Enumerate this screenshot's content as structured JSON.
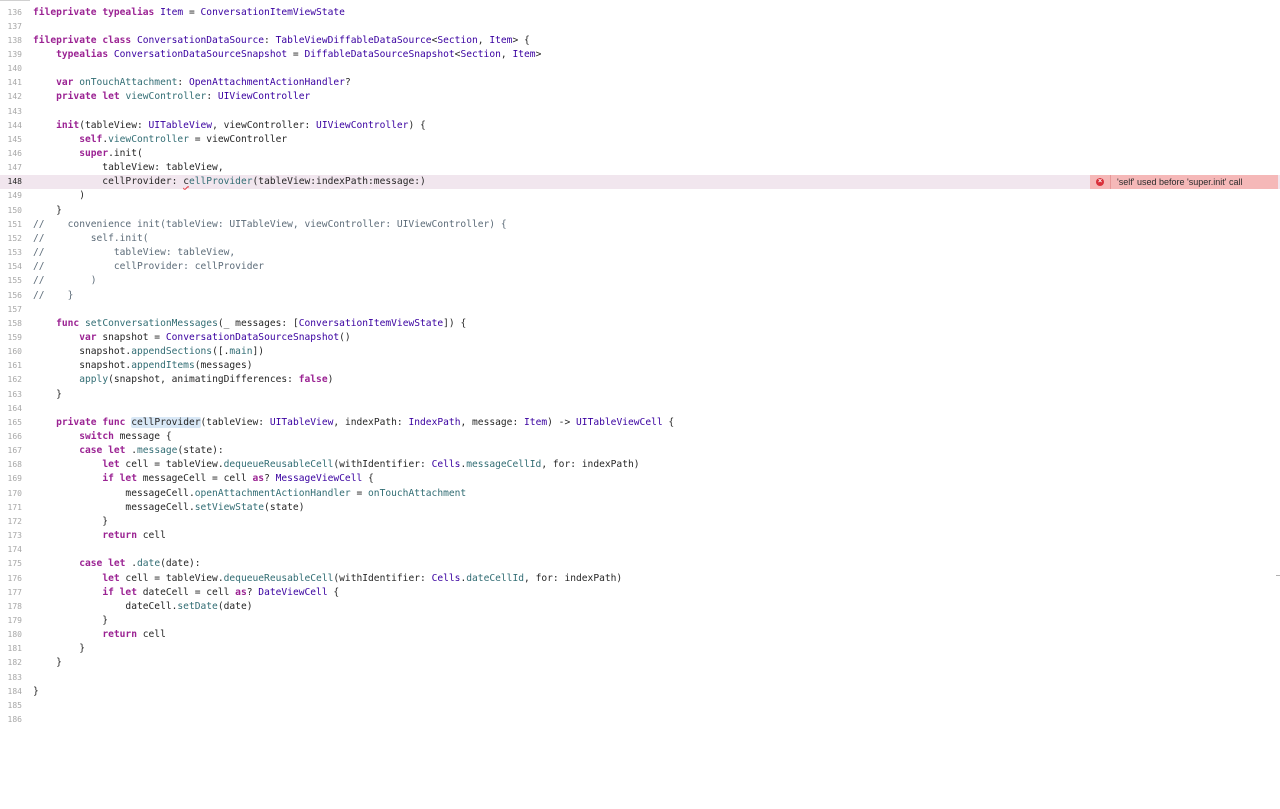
{
  "editor": {
    "error": {
      "line_number": "148",
      "message": "'self' used before 'super.init' call"
    },
    "lines": [
      {
        "n": "136",
        "tokens": [
          [
            "kw",
            "fileprivate "
          ],
          [
            "kw",
            "typealias "
          ],
          [
            "ty",
            "Item"
          ],
          [
            "tx",
            " = "
          ],
          [
            "ty",
            "ConversationItemViewState"
          ]
        ]
      },
      {
        "n": "137",
        "tokens": []
      },
      {
        "n": "138",
        "tokens": [
          [
            "kw",
            "fileprivate "
          ],
          [
            "kw",
            "class "
          ],
          [
            "ty",
            "ConversationDataSource"
          ],
          [
            "tx",
            ": "
          ],
          [
            "ty",
            "TableViewDiffableDataSource"
          ],
          [
            "tx",
            "<"
          ],
          [
            "ty",
            "Section"
          ],
          [
            "tx",
            ", "
          ],
          [
            "ty",
            "Item"
          ],
          [
            "tx",
            "> {"
          ]
        ]
      },
      {
        "n": "139",
        "tokens": [
          [
            "tx",
            "    "
          ],
          [
            "kw",
            "typealias "
          ],
          [
            "ty",
            "ConversationDataSourceSnapshot"
          ],
          [
            "tx",
            " = "
          ],
          [
            "ty",
            "DiffableDataSourceSnapshot"
          ],
          [
            "tx",
            "<"
          ],
          [
            "ty",
            "Section"
          ],
          [
            "tx",
            ", "
          ],
          [
            "ty",
            "Item"
          ],
          [
            "tx",
            ">"
          ]
        ]
      },
      {
        "n": "140",
        "tokens": []
      },
      {
        "n": "141",
        "tokens": [
          [
            "tx",
            "    "
          ],
          [
            "kw",
            "var "
          ],
          [
            "fn",
            "onTouchAttachment"
          ],
          [
            "tx",
            ": "
          ],
          [
            "ty",
            "OpenAttachmentActionHandler"
          ],
          [
            "tx",
            "?"
          ]
        ]
      },
      {
        "n": "142",
        "tokens": [
          [
            "tx",
            "    "
          ],
          [
            "kw",
            "private "
          ],
          [
            "kw",
            "let "
          ],
          [
            "fn",
            "viewController"
          ],
          [
            "tx",
            ": "
          ],
          [
            "ty",
            "UIViewController"
          ]
        ]
      },
      {
        "n": "143",
        "tokens": []
      },
      {
        "n": "144",
        "tokens": [
          [
            "tx",
            "    "
          ],
          [
            "kw",
            "init"
          ],
          [
            "tx",
            "(tableView: "
          ],
          [
            "ty",
            "UITableView"
          ],
          [
            "tx",
            ", viewController: "
          ],
          [
            "ty",
            "UIViewController"
          ],
          [
            "tx",
            ") {"
          ]
        ]
      },
      {
        "n": "145",
        "tokens": [
          [
            "tx",
            "        "
          ],
          [
            "kw",
            "self"
          ],
          [
            "tx",
            "."
          ],
          [
            "fn",
            "viewController"
          ],
          [
            "tx",
            " = viewController"
          ]
        ]
      },
      {
        "n": "146",
        "tokens": [
          [
            "tx",
            "        "
          ],
          [
            "kw",
            "super"
          ],
          [
            "tx",
            ".init("
          ]
        ]
      },
      {
        "n": "147",
        "tokens": [
          [
            "tx",
            "            tableView: tableView,"
          ]
        ]
      },
      {
        "n": "148",
        "error": true,
        "tokens": [
          [
            "tx",
            "            cellProvider: "
          ],
          [
            "err",
            "c"
          ],
          [
            "fn",
            "ellProvider"
          ],
          [
            "tx",
            "(tableView:indexPath:message:)"
          ]
        ]
      },
      {
        "n": "149",
        "tokens": [
          [
            "tx",
            "        )"
          ]
        ]
      },
      {
        "n": "150",
        "tokens": [
          [
            "tx",
            "    }"
          ]
        ]
      },
      {
        "n": "151",
        "tokens": [
          [
            "cm",
            "//    convenience init(tableView: UITableView, viewController: UIViewController) {"
          ]
        ]
      },
      {
        "n": "152",
        "tokens": [
          [
            "cm",
            "//        self.init("
          ]
        ]
      },
      {
        "n": "153",
        "tokens": [
          [
            "cm",
            "//            tableView: tableView,"
          ]
        ]
      },
      {
        "n": "154",
        "tokens": [
          [
            "cm",
            "//            cellProvider: cellProvider"
          ]
        ]
      },
      {
        "n": "155",
        "tokens": [
          [
            "cm",
            "//        )"
          ]
        ]
      },
      {
        "n": "156",
        "tokens": [
          [
            "cm",
            "//    }"
          ]
        ]
      },
      {
        "n": "157",
        "tokens": []
      },
      {
        "n": "158",
        "tokens": [
          [
            "tx",
            "    "
          ],
          [
            "kw",
            "func "
          ],
          [
            "fn",
            "setConversationMessages"
          ],
          [
            "tx",
            "(_ messages: ["
          ],
          [
            "ty",
            "ConversationItemViewState"
          ],
          [
            "tx",
            "]) {"
          ]
        ]
      },
      {
        "n": "159",
        "tokens": [
          [
            "tx",
            "        "
          ],
          [
            "kw",
            "var "
          ],
          [
            "tx",
            "snapshot = "
          ],
          [
            "ty",
            "ConversationDataSourceSnapshot"
          ],
          [
            "tx",
            "()"
          ]
        ]
      },
      {
        "n": "160",
        "tokens": [
          [
            "tx",
            "        snapshot."
          ],
          [
            "fn",
            "appendSections"
          ],
          [
            "tx",
            "([."
          ],
          [
            "fn",
            "main"
          ],
          [
            "tx",
            "])"
          ]
        ]
      },
      {
        "n": "161",
        "tokens": [
          [
            "tx",
            "        snapshot."
          ],
          [
            "fn",
            "appendItems"
          ],
          [
            "tx",
            "(messages)"
          ]
        ]
      },
      {
        "n": "162",
        "tokens": [
          [
            "tx",
            "        "
          ],
          [
            "fn",
            "apply"
          ],
          [
            "tx",
            "(snapshot, animatingDifferences: "
          ],
          [
            "kw",
            "false"
          ],
          [
            "tx",
            ")"
          ]
        ]
      },
      {
        "n": "163",
        "tokens": [
          [
            "tx",
            "    }"
          ]
        ]
      },
      {
        "n": "164",
        "tokens": []
      },
      {
        "n": "165",
        "tokens": [
          [
            "tx",
            "    "
          ],
          [
            "kw",
            "private "
          ],
          [
            "kw",
            "func "
          ],
          [
            "hl",
            "cellProvider"
          ],
          [
            "tx",
            "(tableView: "
          ],
          [
            "ty",
            "UITableView"
          ],
          [
            "tx",
            ", indexPath: "
          ],
          [
            "ty",
            "IndexPath"
          ],
          [
            "tx",
            ", message: "
          ],
          [
            "ty",
            "Item"
          ],
          [
            "tx",
            ") -> "
          ],
          [
            "ty",
            "UITableViewCell"
          ],
          [
            "tx",
            " {"
          ]
        ]
      },
      {
        "n": "166",
        "tokens": [
          [
            "tx",
            "        "
          ],
          [
            "kw",
            "switch "
          ],
          [
            "tx",
            "message {"
          ]
        ]
      },
      {
        "n": "167",
        "tokens": [
          [
            "tx",
            "        "
          ],
          [
            "kw",
            "case "
          ],
          [
            "kw",
            "let "
          ],
          [
            "tx",
            "."
          ],
          [
            "fn",
            "message"
          ],
          [
            "tx",
            "(state):"
          ]
        ]
      },
      {
        "n": "168",
        "tokens": [
          [
            "tx",
            "            "
          ],
          [
            "kw",
            "let "
          ],
          [
            "tx",
            "cell = tableView."
          ],
          [
            "fn",
            "dequeueReusableCell"
          ],
          [
            "tx",
            "(withIdentifier: "
          ],
          [
            "ty",
            "Cells"
          ],
          [
            "tx",
            "."
          ],
          [
            "fn",
            "messageCellId"
          ],
          [
            "tx",
            ", for: indexPath)"
          ]
        ]
      },
      {
        "n": "169",
        "tokens": [
          [
            "tx",
            "            "
          ],
          [
            "kw",
            "if "
          ],
          [
            "kw",
            "let "
          ],
          [
            "tx",
            "messageCell = cell "
          ],
          [
            "kw",
            "as"
          ],
          [
            "tx",
            "? "
          ],
          [
            "ty",
            "MessageViewCell"
          ],
          [
            "tx",
            " {"
          ]
        ]
      },
      {
        "n": "170",
        "tokens": [
          [
            "tx",
            "                messageCell."
          ],
          [
            "fn",
            "openAttachmentActionHandler"
          ],
          [
            "tx",
            " = "
          ],
          [
            "fn",
            "onTouchAttachment"
          ]
        ]
      },
      {
        "n": "171",
        "tokens": [
          [
            "tx",
            "                messageCell."
          ],
          [
            "fn",
            "setViewState"
          ],
          [
            "tx",
            "(state)"
          ]
        ]
      },
      {
        "n": "172",
        "tokens": [
          [
            "tx",
            "            }"
          ]
        ]
      },
      {
        "n": "173",
        "tokens": [
          [
            "tx",
            "            "
          ],
          [
            "kw",
            "return "
          ],
          [
            "tx",
            "cell"
          ]
        ]
      },
      {
        "n": "174",
        "tokens": []
      },
      {
        "n": "175",
        "tokens": [
          [
            "tx",
            "        "
          ],
          [
            "kw",
            "case "
          ],
          [
            "kw",
            "let "
          ],
          [
            "tx",
            "."
          ],
          [
            "fn",
            "date"
          ],
          [
            "tx",
            "(date):"
          ]
        ]
      },
      {
        "n": "176",
        "tokens": [
          [
            "tx",
            "            "
          ],
          [
            "kw",
            "let "
          ],
          [
            "tx",
            "cell = tableView."
          ],
          [
            "fn",
            "dequeueReusableCell"
          ],
          [
            "tx",
            "(withIdentifier: "
          ],
          [
            "ty",
            "Cells"
          ],
          [
            "tx",
            "."
          ],
          [
            "fn",
            "dateCellId"
          ],
          [
            "tx",
            ", for: indexPath)"
          ]
        ]
      },
      {
        "n": "177",
        "tokens": [
          [
            "tx",
            "            "
          ],
          [
            "kw",
            "if "
          ],
          [
            "kw",
            "let "
          ],
          [
            "tx",
            "dateCell = cell "
          ],
          [
            "kw",
            "as"
          ],
          [
            "tx",
            "? "
          ],
          [
            "ty",
            "DateViewCell"
          ],
          [
            "tx",
            " {"
          ]
        ]
      },
      {
        "n": "178",
        "tokens": [
          [
            "tx",
            "                dateCell."
          ],
          [
            "fn",
            "setDate"
          ],
          [
            "tx",
            "(date)"
          ]
        ]
      },
      {
        "n": "179",
        "tokens": [
          [
            "tx",
            "            }"
          ]
        ]
      },
      {
        "n": "180",
        "tokens": [
          [
            "tx",
            "            "
          ],
          [
            "kw",
            "return "
          ],
          [
            "tx",
            "cell"
          ]
        ]
      },
      {
        "n": "181",
        "tokens": [
          [
            "tx",
            "        }"
          ]
        ]
      },
      {
        "n": "182",
        "tokens": [
          [
            "tx",
            "    }"
          ]
        ]
      },
      {
        "n": "183",
        "tokens": []
      },
      {
        "n": "184",
        "tokens": [
          [
            "tx",
            "}"
          ]
        ]
      },
      {
        "n": "185",
        "tokens": []
      },
      {
        "n": "186",
        "tokens": []
      }
    ]
  },
  "colors": {
    "keyword": "#9b2393",
    "type": "#3900a0",
    "identifier": "#326d74",
    "comment": "#5d6c79",
    "error": "#d9303a",
    "error_line_bg": "#f1e6ee"
  }
}
